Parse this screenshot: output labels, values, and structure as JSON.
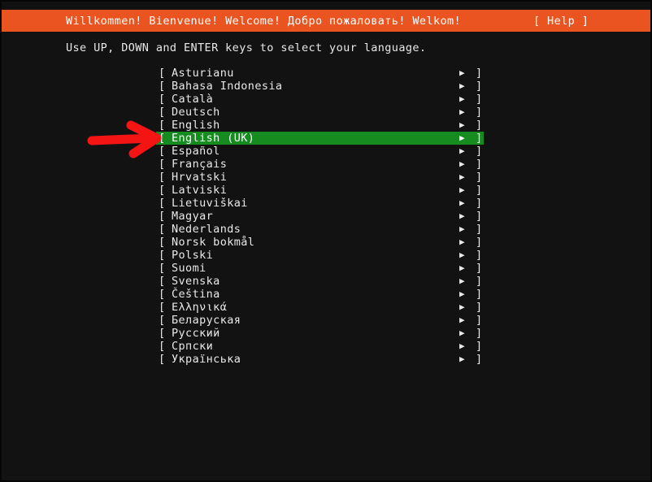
{
  "header": {
    "title": "Willkommen! Bienvenue! Welcome! Добро пожаловать! Welkom!",
    "help_label": "[ Help ]",
    "background_color": "#e95420",
    "text_color": "#ffffff"
  },
  "main": {
    "instruction": "Use UP, DOWN and ENTER keys to select your language.",
    "background_color": "#121212",
    "text_color": "#e8e8e8"
  },
  "language_list": {
    "open_bracket": "[",
    "close_bracket": "]",
    "arrow_glyph": "▶",
    "selected_index": 5,
    "selected_value": "English (UK)",
    "highlight_color": "#168b1f",
    "items": [
      {
        "label": "Asturianu"
      },
      {
        "label": "Bahasa Indonesia"
      },
      {
        "label": "Català"
      },
      {
        "label": "Deutsch"
      },
      {
        "label": "English"
      },
      {
        "label": "English (UK)"
      },
      {
        "label": "Español"
      },
      {
        "label": "Français"
      },
      {
        "label": "Hrvatski"
      },
      {
        "label": "Latviski"
      },
      {
        "label": "Lietuviškai"
      },
      {
        "label": "Magyar"
      },
      {
        "label": "Nederlands"
      },
      {
        "label": "Norsk bokmål"
      },
      {
        "label": "Polski"
      },
      {
        "label": "Suomi"
      },
      {
        "label": "Svenska"
      },
      {
        "label": "Čeština"
      },
      {
        "label": "Ελληνικά"
      },
      {
        "label": "Беларуская"
      },
      {
        "label": "Русский"
      },
      {
        "label": "Српски"
      },
      {
        "label": "Українська"
      }
    ]
  },
  "annotation": {
    "arrow_color": "#f41414",
    "points_at": "English (UK)"
  }
}
